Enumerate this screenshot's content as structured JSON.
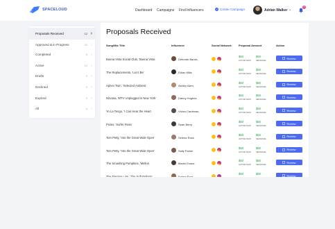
{
  "brand": {
    "name": "SPACELOUD"
  },
  "nav": {
    "dashboard": "Dashboard",
    "campaigns": "Campaigns",
    "find_influencers": "Find Influencers",
    "create_campaign": "Create Campaign"
  },
  "user": {
    "name": "Adrian Walker",
    "notifications": "5"
  },
  "sidebar": {
    "items": [
      {
        "label": "Proposals Received",
        "count": "12"
      },
      {
        "label": "Approved & in Progress",
        "count": "34"
      },
      {
        "label": "Completed",
        "count": "9"
      },
      {
        "label": "Active",
        "count": "12"
      },
      {
        "label": "Drafts",
        "count": "0"
      },
      {
        "label": "Declined",
        "count": "0"
      },
      {
        "label": "Expired",
        "count": "0"
      },
      {
        "label": "All",
        "count": "4"
      }
    ]
  },
  "main": {
    "title": "Proposals Received",
    "columns": {
      "song": "Song/Mix Title",
      "influencer": "Influencer",
      "social": "Social Network",
      "amount": "Proposal Amount",
      "action": "Action"
    },
    "review_label": "Review",
    "rows": [
      {
        "song": "Buena Vista Social Club, 'Buena Vista",
        "influencer": "Deborah Banks",
        "amount1": "$50",
        "sub1": "ACTIVE NOW",
        "amount2": "$50",
        "sub2": "SEASONAL"
      },
      {
        "song": "The Replacements, 'Let It Be'",
        "influencer": "Ethan Mills",
        "amount1": "$50",
        "sub1": "ACTIVE NOW",
        "amount2": "$50",
        "sub2": "SEASONAL"
      },
      {
        "song": "Aphex Twin, 'Selected Ambient",
        "influencer": "Ashley Allen",
        "amount1": "$50",
        "sub1": "ACTIVE NOW",
        "amount2": "$50",
        "sub2": "SEASONAL"
      },
      {
        "song": "Nirvana, 'MTV Unplugged in New York'",
        "influencer": "Danny Hughes",
        "amount1": "$50",
        "sub1": "ACTIVE NOW",
        "amount2": "$50",
        "sub2": "SEASONAL"
      },
      {
        "song": "Yo La Tengo, 'I Can Hear the Heart",
        "influencer": "Vivian Cardenas",
        "amount1": "$50",
        "sub1": "ACTIVE NOW",
        "amount2": "$50",
        "sub2": "SEASONAL"
      },
      {
        "song": "Pixies, 'Surfer Rosa'",
        "influencer": "Sean Berry",
        "amount1": "$50",
        "sub1": "ACTIVE NOW",
        "amount2": "$50",
        "sub2": "SEASONAL"
      },
      {
        "song": "Tom Petty, 'Into the Great Wide Open'",
        "influencer": "Selena Ross",
        "amount1": "$50",
        "sub1": "ACTIVE NOW",
        "amount2": "$50",
        "sub2": "SEASONAL"
      },
      {
        "song": "Tom Petty, 'Into the Great Wide Open'",
        "influencer": "Sally Parker",
        "amount1": "$50",
        "sub1": "ACTIVE NOW",
        "amount2": "$50",
        "sub2": "SEASONAL"
      },
      {
        "song": "The Smashing Pumpkins, 'Mellon",
        "influencer": "Martin Evans",
        "amount1": "$50",
        "sub1": "ACTIVE NOW",
        "amount2": "$50",
        "sub2": "SEASONAL"
      },
      {
        "song": "The Flaming Lips, 'The Soft Bulletin'",
        "influencer": "Emma Ross",
        "amount1": "$50",
        "sub1": "ACTIVE NOW",
        "amount2": "$50",
        "sub2": "SEASONAL"
      }
    ]
  },
  "colors": {
    "accent": "#4d6bf0",
    "price": "#1ba545",
    "brand": "#3d5bd9"
  },
  "icons": {
    "social": [
      "snapchat-icon",
      "instagram-icon"
    ],
    "review": "document-icon",
    "bell": "bell-icon"
  }
}
